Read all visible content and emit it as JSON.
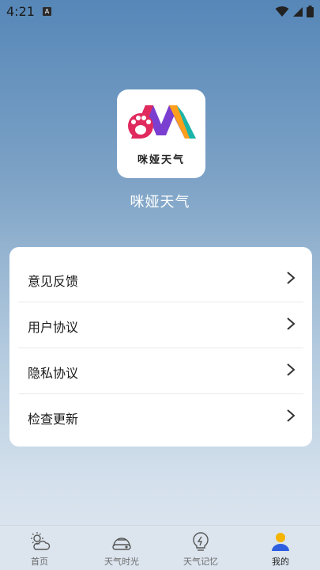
{
  "status_bar": {
    "time": "4:21",
    "notification_badge": "A"
  },
  "app": {
    "name": "咪娅天气",
    "logo_text": "咪娅天气"
  },
  "menu": [
    {
      "label": "意见反馈"
    },
    {
      "label": "用户协议"
    },
    {
      "label": "隐私协议"
    },
    {
      "label": "检查更新"
    }
  ],
  "tabbar": [
    {
      "label": "首页",
      "icon": "weather-sun-cloud-icon"
    },
    {
      "label": "天气时光",
      "icon": "weather-time-icon"
    },
    {
      "label": "天气记忆",
      "icon": "lightning-bulb-icon"
    },
    {
      "label": "我的",
      "icon": "user-profile-icon",
      "active": true
    }
  ],
  "colors": {
    "accent": "#2f5fe0",
    "logo_pink": "#e02a5e",
    "logo_purple": "#7a3fd0"
  }
}
